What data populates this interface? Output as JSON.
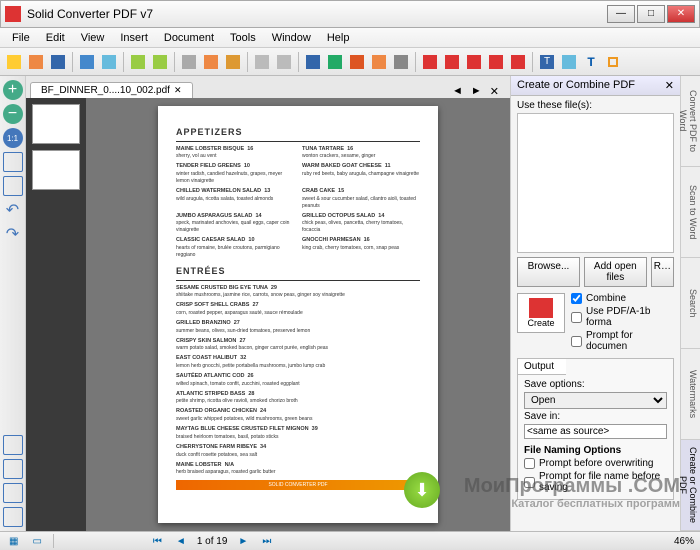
{
  "window": {
    "title": "Solid Converter PDF v7"
  },
  "menu": [
    "File",
    "Edit",
    "View",
    "Insert",
    "Document",
    "Tools",
    "Window",
    "Help"
  ],
  "tab": {
    "label": "BF_DINNER_0....10_002.pdf"
  },
  "page": {
    "appetizers_title": "APPETIZERS",
    "entrees_title": "ENTRÉES",
    "appetizers": [
      {
        "name": "MAINE LOBSTER BISQUE",
        "desc": "sherry, vol au vent",
        "price": "16"
      },
      {
        "name": "TUNA TARTARE",
        "desc": "wonton crackers, sesame, ginger",
        "price": "16"
      },
      {
        "name": "TENDER FIELD GREENS",
        "desc": "winter radish, candied hazelnuts, grapes, meyer lemon vinaigrette",
        "price": "10"
      },
      {
        "name": "WARM BAKED GOAT CHEESE",
        "desc": "ruby red beets, baby arugula, champagne vinaigrette",
        "price": "11"
      },
      {
        "name": "CHILLED WATERMELON SALAD",
        "desc": "wild arugula, ricotta salata, toasted almonds",
        "price": "13"
      },
      {
        "name": "CRAB CAKE",
        "desc": "sweet & sour cucumber salad, cilantro aioli, toasted peanuts",
        "price": "15"
      },
      {
        "name": "JUMBO ASPARAGUS SALAD",
        "desc": "speck, marinated anchovies, quail eggs, caper coin vinaigrette",
        "price": "14"
      },
      {
        "name": "GRILLED OCTOPUS SALAD",
        "desc": "chick peas, olives, pancetta, cherry tomatoes, focaccia",
        "price": "14"
      },
      {
        "name": "CLASSIC CAESAR SALAD",
        "desc": "hearts of romaine, brulée croutons, parmigiano reggiano",
        "price": "10"
      },
      {
        "name": "GNOCCHI PARMESAN",
        "desc": "king crab, cherry tomatoes, corn, snap peas",
        "price": "16"
      }
    ],
    "entrees": [
      {
        "name": "SESAME CRUSTED BIG EYE TUNA",
        "desc": "shiitake mushrooms, jasmine rice, carrots, snow peas, ginger soy vinaigrette",
        "price": "29"
      },
      {
        "name": "CRISP SOFT SHELL CRABS",
        "desc": "corn, roasted pepper, asparagus sauté, sauce rémoulade",
        "price": "27"
      },
      {
        "name": "GRILLED BRANZINO",
        "desc": "summer beans, olives, sun-dried tomatoes, preserved lemon",
        "price": "27"
      },
      {
        "name": "CRISPY SKIN SALMON",
        "desc": "warm potato salad, smoked bacon, ginger carrot purée, english peas",
        "price": "27"
      },
      {
        "name": "EAST COAST HALIBUT",
        "desc": "lemon herb gnocchi, petite portabella mushrooms, jumbo lump crab",
        "price": "32"
      },
      {
        "name": "SAUTÉED ATLANTIC COD",
        "desc": "wilted spinach, tomato confit, zucchini, roasted eggplant",
        "price": "26"
      },
      {
        "name": "ATLANTIC STRIPED BASS",
        "desc": "petite shrimp, ricotta olive ravioli, smoked chorizo broth",
        "price": "28"
      },
      {
        "name": "ROASTED ORGANIC CHICKEN",
        "desc": "sweet garlic whipped potatoes, wild mushrooms, green beans",
        "price": "24"
      },
      {
        "name": "MAYTAG BLUE CHEESE CRUSTED FILET MIGNON",
        "desc": "braised heirloom tomatoes, basil, potato sticks",
        "price": "39"
      },
      {
        "name": "CHERRYSTONE FARM RIBEYE",
        "desc": "duck confit rosette potatoes, sea salt",
        "price": "34"
      },
      {
        "name": "MAINE LOBSTER",
        "desc": "herb braised asparagus, roasted garlic butter",
        "price": "N/A"
      }
    ],
    "footer": "SOLID CONVERTER PDF"
  },
  "rightpanel": {
    "title": "Create or Combine PDF",
    "files_label": "Use these file(s):",
    "browse": "Browse...",
    "addopen": "Add open files",
    "remove": "R…",
    "create": "Create",
    "combine": "Combine",
    "pdfa": "Use PDF/A-1b forma",
    "prompt_doc": "Prompt for documen",
    "output_tab": "Output",
    "save_options": "Save options:",
    "save_opt_open": "Open",
    "save_in": "Save in:",
    "save_in_val": "<same as source>",
    "naming": "File Naming Options",
    "prompt_overwrite": "Prompt before overwriting",
    "prompt_filename": "Prompt for file name before saving"
  },
  "sidetabs": [
    "Convert PDF to Word",
    "Scan to Word",
    "Search",
    "Watermarks",
    "Create or Combine PDF"
  ],
  "status": {
    "page_info": "1 of 19",
    "zoom": "46%"
  },
  "watermark": {
    "main": "МоиПрограммы .COM",
    "sub": "Каталог бесплатных программ"
  }
}
